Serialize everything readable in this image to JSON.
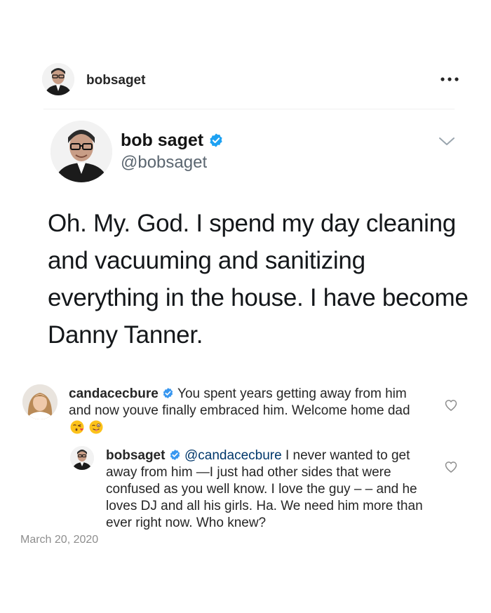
{
  "post": {
    "username": "bobsaget",
    "date": "March 20, 2020"
  },
  "tweet": {
    "name": "bob saget",
    "handle": "@bobsaget",
    "body": "Oh. My. God. I spend my day cleaning and vacuuming and sanitizing everything in the house. I have become Danny Tanner."
  },
  "comments": [
    {
      "username": "candacecbure",
      "text": "You spent years getting away from him and now youve finally embraced him. Welcome home dad",
      "emojis": [
        "face-blowing-kiss",
        "winking-face-with-tongue"
      ]
    },
    {
      "username": "bobsaget",
      "mention": "@candacecbure",
      "text": "I never wanted to get away from him —I just had other sides that were confused as you well know. I love the guy – – and he loves DJ and all his girls. Ha. We need him more than ever right now. Who knew?"
    }
  ],
  "icons": {
    "verified_color": "#1da1f2",
    "heart_color": "#8e8e8e"
  }
}
